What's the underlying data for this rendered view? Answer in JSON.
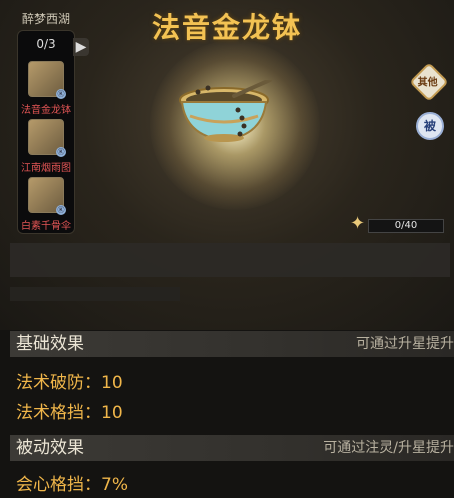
{
  "header": {
    "title": "法音金龙钵"
  },
  "sidebar": {
    "title": "醉梦西湖",
    "count": "0/3",
    "arrow": "▶",
    "items": [
      {
        "label": "法音金龙钵",
        "tag": "Ⓚ"
      },
      {
        "label": "江南烟雨图",
        "tag": "Ⓚ"
      },
      {
        "label": "白素千骨伞",
        "tag": "Ⓚ"
      }
    ]
  },
  "side_buttons": {
    "other": "其他",
    "passive": "被"
  },
  "star_progress": {
    "text": "0/40",
    "value": 0,
    "max": 40
  },
  "basic_effect": {
    "title": "基础效果",
    "hint": "可通过升星提升",
    "stats": [
      {
        "text": "法术破防：10"
      },
      {
        "text": "法术格挡：10"
      }
    ]
  },
  "passive_effect": {
    "title": "被动效果",
    "hint": "可通过注灵/升星提升",
    "stats": [
      {
        "text": "会心格挡：7%"
      }
    ]
  },
  "colors": {
    "title": "#f3c253",
    "stat": "#f0b64a",
    "warning_label": "#e25555"
  }
}
